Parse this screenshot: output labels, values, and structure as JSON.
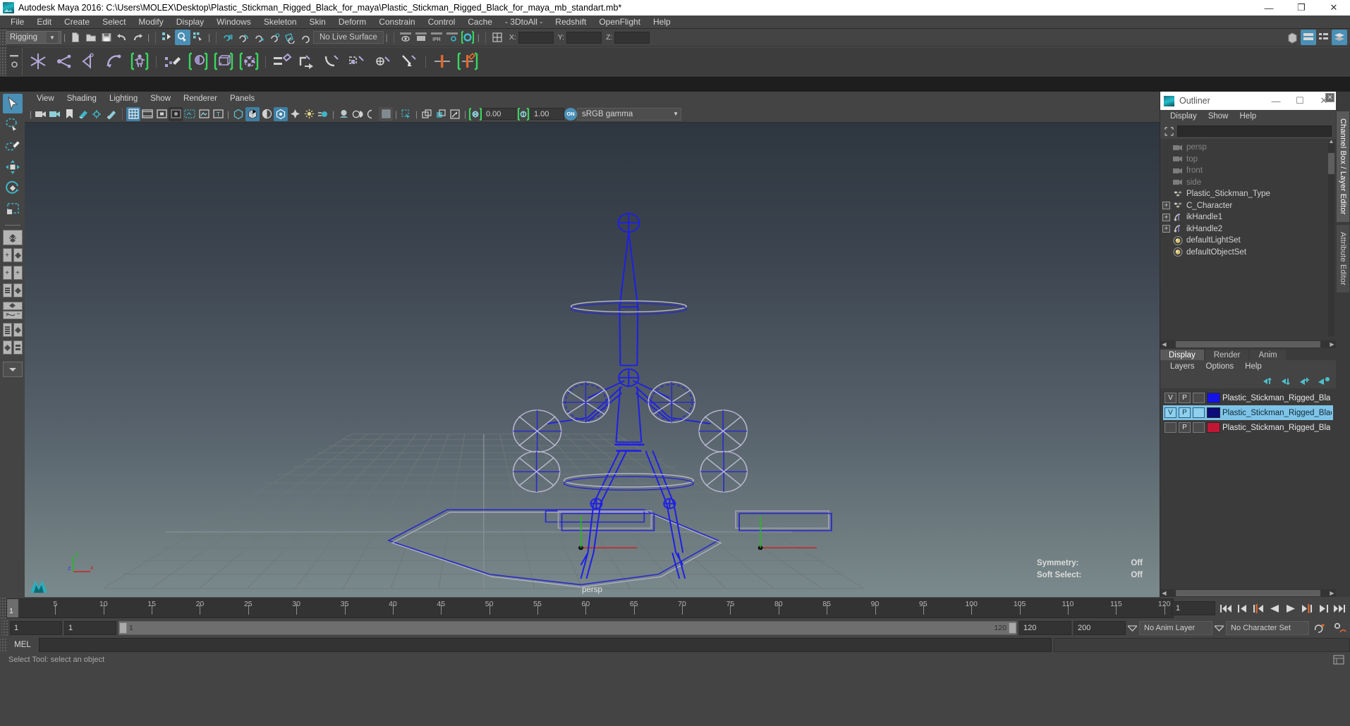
{
  "titlebar": {
    "app_title": "Autodesk Maya 2016: C:\\Users\\MOLEX\\Desktop\\Plastic_Stickman_Rigged_Black_for_maya\\Plastic_Stickman_Rigged_Black_for_maya_mb_standart.mb*",
    "minimize": "—",
    "restore": "❐",
    "close": "✕"
  },
  "menubar": {
    "items": [
      "File",
      "Edit",
      "Create",
      "Select",
      "Modify",
      "Display",
      "Windows",
      "Skeleton",
      "Skin",
      "Deform",
      "Constrain",
      "Control",
      "Cache",
      "- 3DtoAll -",
      "Redshift",
      "OpenFlight",
      "Help"
    ]
  },
  "statusline": {
    "menuset_value": "Rigging",
    "live_surface": "No Live Surface",
    "coord_labels": {
      "x": "X:",
      "y": "Y:",
      "z": "Z:"
    },
    "coord_values": {
      "x": "",
      "y": "",
      "z": ""
    }
  },
  "viewport_menu": {
    "items": [
      "View",
      "Shading",
      "Lighting",
      "Show",
      "Renderer",
      "Panels"
    ]
  },
  "viewport_toolbar": {
    "exposure_value": "0.00",
    "gamma_value": "1.00",
    "color_management_toggle": "ON",
    "view_transform": "sRGB gamma"
  },
  "viewport": {
    "camera_label": "persp",
    "hud": [
      {
        "label": "Symmetry:",
        "value": "Off"
      },
      {
        "label": "Soft Select:",
        "value": "Off"
      }
    ],
    "axis_gizmo": {
      "x": "x",
      "y": "y",
      "z": "z"
    },
    "ground_axis": {
      "x_left": "X",
      "x_right": "X",
      "y": "y",
      "z": "z"
    },
    "colors": {
      "rig_wire": "#1a1ae0",
      "control_wire": "#a9a9c4",
      "grid": "#6d7878",
      "axis_x": "#cc2222",
      "axis_y": "#22bb22",
      "axis_z": "#2233cc"
    }
  },
  "outliner": {
    "title": "Outliner",
    "window_buttons": {
      "minimize": "—",
      "maximize": "☐",
      "close": "✕"
    },
    "menu": [
      "Display",
      "Show",
      "Help"
    ],
    "search_value": "",
    "items": [
      {
        "label": "persp",
        "icon": "camera-icon",
        "dimmed": true,
        "expandable": false
      },
      {
        "label": "top",
        "icon": "camera-icon",
        "dimmed": true,
        "expandable": false
      },
      {
        "label": "front",
        "icon": "camera-icon",
        "dimmed": true,
        "expandable": false
      },
      {
        "label": "side",
        "icon": "camera-icon",
        "dimmed": true,
        "expandable": false
      },
      {
        "label": "Plastic_Stickman_Type",
        "icon": "group-icon",
        "dimmed": false,
        "expandable": false
      },
      {
        "label": "C_Character",
        "icon": "group-icon",
        "dimmed": false,
        "expandable": true
      },
      {
        "label": "ikHandle1",
        "icon": "ik-handle-icon",
        "dimmed": false,
        "expandable": true
      },
      {
        "label": "ikHandle2",
        "icon": "ik-handle-icon",
        "dimmed": false,
        "expandable": true
      },
      {
        "label": "defaultLightSet",
        "icon": "set-icon",
        "dimmed": false,
        "expandable": false
      },
      {
        "label": "defaultObjectSet",
        "icon": "set-icon",
        "dimmed": false,
        "expandable": false
      }
    ],
    "expander_symbol": "+"
  },
  "layer_editor": {
    "tabs": [
      {
        "label": "Display",
        "selected": true
      },
      {
        "label": "Render",
        "selected": false
      },
      {
        "label": "Anim",
        "selected": false
      }
    ],
    "menu": [
      "Layers",
      "Options",
      "Help"
    ],
    "layers": [
      {
        "visibility": "V",
        "playback": "P",
        "third": "",
        "color": "#1313ea",
        "name": "Plastic_Stickman_Rigged_Bla",
        "selected": false
      },
      {
        "visibility": "V",
        "playback": "P",
        "third": "",
        "color": "#0c0c7a",
        "name": "Plastic_Stickman_Rigged_Black_FBX",
        "selected": true
      },
      {
        "visibility": "",
        "playback": "P",
        "third": "",
        "color": "#c21634",
        "name": "Plastic_Stickman_Rigged_Bla",
        "selected": false
      }
    ]
  },
  "right_vtabs": [
    {
      "label": "Channel Box / Layer Editor",
      "selected": true
    },
    {
      "label": "Attribute Editor",
      "selected": false
    }
  ],
  "timeline": {
    "current_frame": "1",
    "start_display": "1",
    "tick_labels": [
      "5",
      "10",
      "15",
      "20",
      "25",
      "30",
      "35",
      "40",
      "45",
      "50",
      "55",
      "60",
      "65",
      "70",
      "75",
      "80",
      "85",
      "90",
      "95",
      "100",
      "105",
      "110",
      "115",
      "120"
    ],
    "range_start": "1",
    "range_end": "1",
    "playback_start": "1",
    "playback_end": "120",
    "anim_start": "120",
    "anim_end": "200",
    "frame_field": "1",
    "anim_layer": "No Anim Layer",
    "character_set": "No Character Set"
  },
  "playback_buttons": [
    "go-to-start",
    "step-back-key",
    "step-back-frame",
    "play-backwards",
    "play-forwards",
    "step-forward-frame",
    "step-forward-key",
    "go-to-end"
  ],
  "command_line": {
    "language_label": "MEL",
    "command_value": "",
    "result_value": ""
  },
  "status_bar": {
    "message": "Select Tool: select an object"
  },
  "toolbox": {
    "tools": [
      {
        "name": "select-tool",
        "active": true
      },
      {
        "name": "lasso-select-tool",
        "active": false
      },
      {
        "name": "paint-select-tool",
        "active": false
      },
      {
        "name": "move-tool",
        "active": false
      },
      {
        "name": "rotate-tool",
        "active": false
      },
      {
        "name": "scale-tool",
        "active": false
      }
    ],
    "layout_presets": [
      "single-perspective-layout",
      "four-view-layout",
      "outliner-persp-layout",
      "persp-graph-layout",
      "hypershade-persp-layout",
      "persp-graph-outliner-layout"
    ]
  }
}
